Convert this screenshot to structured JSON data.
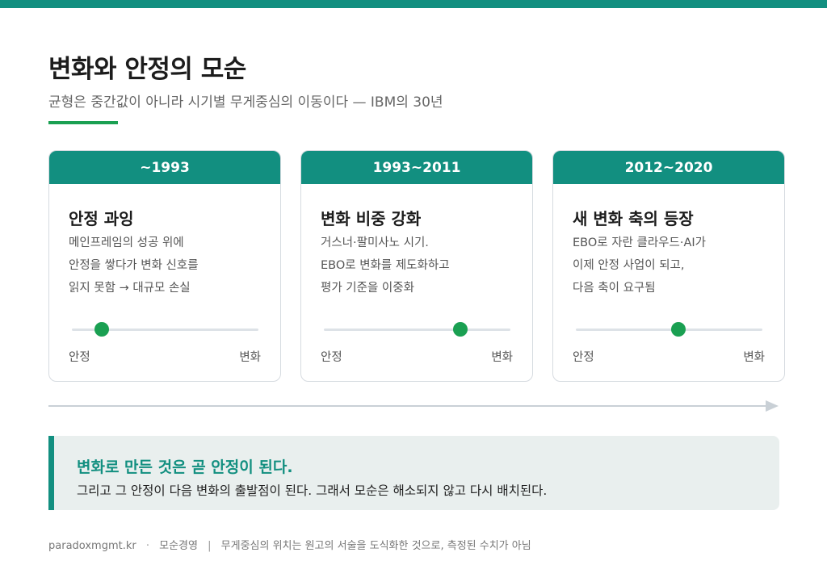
{
  "header": {
    "title": "변화와 안정의 모순",
    "subtitle": "균형은 중간값이 아니라 시기별 무게중심의 이동이다 — IBM의 30년"
  },
  "colors": {
    "accent": "#128f80",
    "green": "#1aa052"
  },
  "cards": [
    {
      "period": "~1993",
      "title": "안정 과잉",
      "desc": [
        "메인프레임의 성공 위에",
        "안정을 쌓다가 변화 신호를",
        "읽지 못함 → 대규모 손실"
      ],
      "balance": 0.16,
      "left_label": "안정",
      "right_label": "변화"
    },
    {
      "period": "1993~2011",
      "title": "변화 비중 강화",
      "desc": [
        "거스너·팔미사노 시기.",
        "EBO로 변화를 제도화하고",
        "평가 기준을 이중화"
      ],
      "balance": 0.73,
      "left_label": "안정",
      "right_label": "변화"
    },
    {
      "period": "2012~2020",
      "title": "새 변화 축의 등장",
      "desc": [
        "EBO로 자란 클라우드·AI가",
        "이제 안정 사업이 되고,",
        "다음 축이 요구됨"
      ],
      "balance": 0.55,
      "left_label": "안정",
      "right_label": "변화"
    }
  ],
  "callout": {
    "title": "변화로 만든 것은 곧 안정이 된다.",
    "body": "그리고 그 안정이 다음 변화의 출발점이 된다. 그래서 모순은 해소되지 않고 다시 배치된다."
  },
  "footer": {
    "site": "paradoxmgmt.kr",
    "dot": "·",
    "section": "모순경영",
    "bar": "|",
    "note": "무게중심의 위치는 원고의 서술을 도식화한 것으로, 측정된 수치가 아님"
  }
}
